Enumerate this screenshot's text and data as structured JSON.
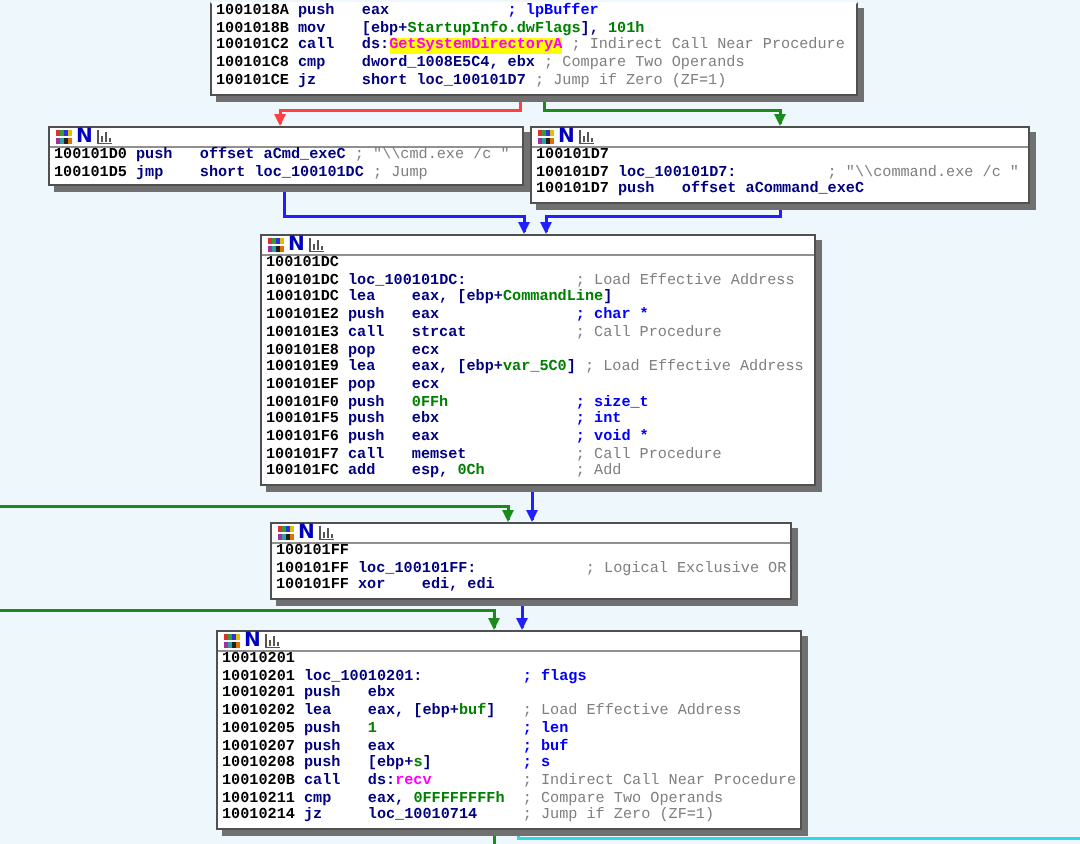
{
  "graph": {
    "nodes": [
      {
        "lines": [
          {
            "kind": "insn",
            "address": "1001018A",
            "mnemonic": "push",
            "operand": [
              {
                "text": "eax",
                "kind": "plain"
              }
            ],
            "comment": {
              "text": "; lpBuffer",
              "kind": "arg"
            }
          },
          {
            "kind": "insn",
            "address": "1001018B",
            "mnemonic": "mov",
            "operand": [
              {
                "text": "[ebp+",
                "kind": "plain"
              },
              {
                "text": "StartupInfo.dwFlags",
                "kind": "member"
              },
              {
                "text": "], ",
                "kind": "plain"
              },
              {
                "text": "101h",
                "kind": "member"
              }
            ]
          },
          {
            "kind": "insn",
            "address": "100101C2",
            "mnemonic": "call",
            "operand": [
              {
                "text": "ds:",
                "kind": "plain"
              },
              {
                "text": "GetSystemDirectoryA",
                "kind": "import_highlighted"
              }
            ],
            "comment": {
              "text": "; Indirect Call Near Procedure",
              "kind": "auto"
            }
          },
          {
            "kind": "insn",
            "address": "100101C8",
            "mnemonic": "cmp",
            "operand": [
              {
                "text": "dword_1008E5C4, ebx",
                "kind": "plain"
              }
            ],
            "comment": {
              "text": "; Compare Two Operands",
              "kind": "auto"
            }
          },
          {
            "kind": "insn",
            "address": "100101CE",
            "mnemonic": "jz",
            "operand": [
              {
                "text": "short loc_100101D7",
                "kind": "plain"
              }
            ],
            "comment": {
              "text": "; Jump if Zero (ZF=1)",
              "kind": "auto"
            }
          }
        ]
      },
      {
        "header": "N",
        "lines": [
          {
            "kind": "insn",
            "address": "100101D0",
            "mnemonic": "push",
            "operand": [
              {
                "text": "offset aCmd_exeC",
                "kind": "plain"
              }
            ],
            "comment": {
              "text": "; \"\\\\cmd.exe /c \"",
              "kind": "auto"
            }
          },
          {
            "kind": "insn",
            "address": "100101D5",
            "mnemonic": "jmp",
            "operand": [
              {
                "text": "short loc_100101DC",
                "kind": "plain"
              }
            ],
            "comment": {
              "text": "; Jump",
              "kind": "auto"
            }
          }
        ]
      },
      {
        "header": "N",
        "lines": [
          {
            "kind": "address",
            "address": "100101D7"
          },
          {
            "kind": "label",
            "address": "100101D7",
            "label": "loc_100101D7:",
            "comment": {
              "text": "; \"\\\\command.exe /c \"",
              "kind": "auto"
            }
          },
          {
            "kind": "insn",
            "address": "100101D7",
            "mnemonic": "push",
            "operand": [
              {
                "text": "offset aCommand_exeC",
                "kind": "plain"
              }
            ]
          }
        ]
      },
      {
        "header": "N",
        "lines": [
          {
            "kind": "address",
            "address": "100101DC"
          },
          {
            "kind": "label",
            "address": "100101DC",
            "label": "loc_100101DC:",
            "comment": {
              "text": "; Load Effective Address",
              "kind": "auto"
            }
          },
          {
            "kind": "insn",
            "address": "100101DC",
            "mnemonic": "lea",
            "operand": [
              {
                "text": "eax, [ebp+",
                "kind": "plain"
              },
              {
                "text": "CommandLine",
                "kind": "member"
              },
              {
                "text": "]",
                "kind": "plain"
              }
            ]
          },
          {
            "kind": "insn",
            "address": "100101E2",
            "mnemonic": "push",
            "operand": [
              {
                "text": "eax",
                "kind": "plain"
              }
            ],
            "comment": {
              "text": "; char *",
              "kind": "arg"
            }
          },
          {
            "kind": "insn",
            "address": "100101E3",
            "mnemonic": "call",
            "operand": [
              {
                "text": "strcat",
                "kind": "plain"
              }
            ],
            "comment": {
              "text": "; Call Procedure",
              "kind": "auto"
            }
          },
          {
            "kind": "insn",
            "address": "100101E8",
            "mnemonic": "pop",
            "operand": [
              {
                "text": "ecx",
                "kind": "plain"
              }
            ]
          },
          {
            "kind": "insn",
            "address": "100101E9",
            "mnemonic": "lea",
            "operand": [
              {
                "text": "eax, [ebp+",
                "kind": "plain"
              },
              {
                "text": "var_5C0",
                "kind": "member"
              },
              {
                "text": "]",
                "kind": "plain"
              }
            ],
            "comment": {
              "text": "; Load Effective Address",
              "kind": "auto"
            }
          },
          {
            "kind": "insn",
            "address": "100101EF",
            "mnemonic": "pop",
            "operand": [
              {
                "text": "ecx",
                "kind": "plain"
              }
            ]
          },
          {
            "kind": "insn",
            "address": "100101F0",
            "mnemonic": "push",
            "operand": [
              {
                "text": "0FFh",
                "kind": "member"
              }
            ],
            "comment": {
              "text": "; size_t",
              "kind": "arg"
            }
          },
          {
            "kind": "insn",
            "address": "100101F5",
            "mnemonic": "push",
            "operand": [
              {
                "text": "ebx",
                "kind": "plain"
              }
            ],
            "comment": {
              "text": "; int",
              "kind": "arg"
            }
          },
          {
            "kind": "insn",
            "address": "100101F6",
            "mnemonic": "push",
            "operand": [
              {
                "text": "eax",
                "kind": "plain"
              }
            ],
            "comment": {
              "text": "; void *",
              "kind": "arg"
            }
          },
          {
            "kind": "insn",
            "address": "100101F7",
            "mnemonic": "call",
            "operand": [
              {
                "text": "memset",
                "kind": "plain"
              }
            ],
            "comment": {
              "text": "; Call Procedure",
              "kind": "auto"
            }
          },
          {
            "kind": "insn",
            "address": "100101FC",
            "mnemonic": "add",
            "operand": [
              {
                "text": "esp, ",
                "kind": "plain"
              },
              {
                "text": "0Ch",
                "kind": "member"
              }
            ],
            "comment": {
              "text": "; Add",
              "kind": "auto"
            }
          }
        ]
      },
      {
        "header": "N",
        "lines": [
          {
            "kind": "address",
            "address": "100101FF"
          },
          {
            "kind": "label",
            "address": "100101FF",
            "label": "loc_100101FF:",
            "comment": {
              "text": "; Logical Exclusive OR",
              "kind": "auto"
            }
          },
          {
            "kind": "insn",
            "address": "100101FF",
            "mnemonic": "xor",
            "operand": [
              {
                "text": "edi, edi",
                "kind": "plain"
              }
            ]
          }
        ]
      },
      {
        "header": "N",
        "lines": [
          {
            "kind": "address",
            "address": "10010201"
          },
          {
            "kind": "label",
            "address": "10010201",
            "label": "loc_10010201:",
            "comment": {
              "text": "; flags",
              "kind": "arg"
            }
          },
          {
            "kind": "insn",
            "address": "10010201",
            "mnemonic": "push",
            "operand": [
              {
                "text": "ebx",
                "kind": "plain"
              }
            ]
          },
          {
            "kind": "insn",
            "address": "10010202",
            "mnemonic": "lea",
            "operand": [
              {
                "text": "eax, [ebp+",
                "kind": "plain"
              },
              {
                "text": "buf",
                "kind": "member"
              },
              {
                "text": "]",
                "kind": "plain"
              }
            ],
            "comment": {
              "text": "; Load Effective Address",
              "kind": "auto"
            }
          },
          {
            "kind": "insn",
            "address": "10010205",
            "mnemonic": "push",
            "operand": [
              {
                "text": "1",
                "kind": "member"
              }
            ],
            "comment": {
              "text": "; len",
              "kind": "arg"
            }
          },
          {
            "kind": "insn",
            "address": "10010207",
            "mnemonic": "push",
            "operand": [
              {
                "text": "eax",
                "kind": "plain"
              }
            ],
            "comment": {
              "text": "; buf",
              "kind": "arg"
            }
          },
          {
            "kind": "insn",
            "address": "10010208",
            "mnemonic": "push",
            "operand": [
              {
                "text": "[ebp+",
                "kind": "plain"
              },
              {
                "text": "s",
                "kind": "member"
              },
              {
                "text": "]",
                "kind": "plain"
              }
            ],
            "comment": {
              "text": "; s",
              "kind": "arg"
            }
          },
          {
            "kind": "insn",
            "address": "1001020B",
            "mnemonic": "call",
            "operand": [
              {
                "text": "ds:",
                "kind": "plain"
              },
              {
                "text": "recv",
                "kind": "import"
              }
            ],
            "comment": {
              "text": "; Indirect Call Near Procedure",
              "kind": "auto"
            }
          },
          {
            "kind": "insn",
            "address": "10010211",
            "mnemonic": "cmp",
            "operand": [
              {
                "text": "eax, ",
                "kind": "plain"
              },
              {
                "text": "0FFFFFFFFh",
                "kind": "member"
              }
            ],
            "comment": {
              "text": "; Compare Two Operands",
              "kind": "auto"
            }
          },
          {
            "kind": "insn",
            "address": "10010214",
            "mnemonic": "jz",
            "operand": [
              {
                "text": "loc_10010714",
                "kind": "plain"
              }
            ],
            "comment": {
              "text": "; Jump if Zero (ZF=1)",
              "kind": "auto"
            }
          }
        ]
      }
    ],
    "edges": [
      {
        "kind": "false"
      },
      {
        "kind": "true"
      },
      {
        "kind": "jump"
      },
      {
        "kind": "jump"
      },
      {
        "kind": "true"
      },
      {
        "kind": "jump"
      },
      {
        "kind": "true"
      },
      {
        "kind": "jump"
      },
      {
        "kind": "true"
      },
      {
        "kind": "selected"
      }
    ]
  }
}
